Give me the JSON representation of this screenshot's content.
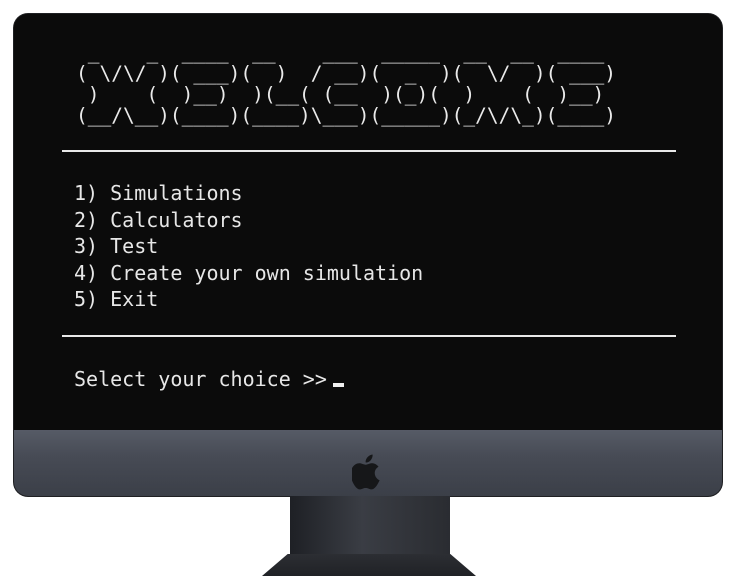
{
  "terminal": {
    "banner_lines": [
      " _    _  ____  __    ___  _____  __  __  ____ ",
      "( \\/\\/ )( ___)(  )  / __)(  _  )(  \\/  )( ___)",
      " )    (  )__)  )(__( (__  )(_)(  )    (  )__) ",
      "(__/\\__)(____)(____)\\___)(_____)(_/\\/\\_)(____)"
    ],
    "menu": [
      {
        "number": "1)",
        "label": "Simulations"
      },
      {
        "number": "2)",
        "label": "Calculators"
      },
      {
        "number": "3)",
        "label": "Test"
      },
      {
        "number": "4)",
        "label": "Create your own simulation"
      },
      {
        "number": "5)",
        "label": "Exit"
      }
    ],
    "prompt": "Select your choice >>"
  },
  "device": {
    "logo_icon": "apple-logo-icon",
    "bezel_color": "#0b0b0c",
    "chin_color": "#4a4e58",
    "text_color": "#e7e7e7"
  }
}
